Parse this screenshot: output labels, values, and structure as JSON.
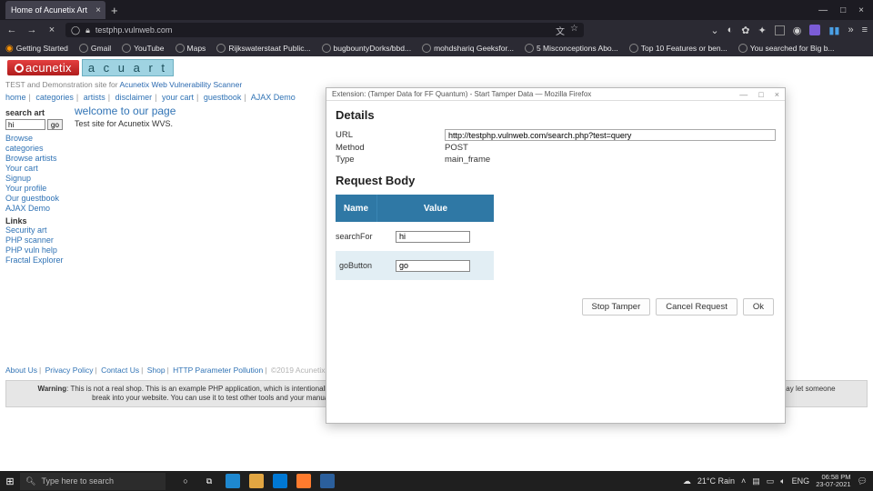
{
  "browser": {
    "tab_title": "Home of Acunetix Art",
    "url": "testphp.vulnweb.com",
    "bookmarks": [
      "Getting Started",
      "Gmail",
      "YouTube",
      "Maps",
      "Rijkswaterstaat Public...",
      "bugbountyDorks/bbd...",
      "mohdshariq Geeksfor...",
      "5 Misconceptions Abo...",
      "Top 10 Features or ben...",
      "You searched for Big b..."
    ]
  },
  "header": {
    "tagline_prefix": "TEST and Demonstration site for ",
    "tagline_link": "Acunetix Web Vulnerability Scanner",
    "menu": [
      "home",
      "categories",
      "artists",
      "disclaimer",
      "your cart",
      "guestbook",
      "AJAX Demo"
    ]
  },
  "sidebar": {
    "search_hdr": "search art",
    "search_value": "hi",
    "go_label": "go",
    "links1": [
      "Browse categories",
      "Browse artists",
      "Your cart",
      "Signup",
      "Your profile",
      "Our guestbook",
      "AJAX Demo"
    ],
    "links_hdr": "Links",
    "links2": [
      "Security art",
      "PHP scanner",
      "PHP vuln help",
      "Fractal Explorer"
    ]
  },
  "main": {
    "title": "welcome to our page",
    "text": "Test site for Acunetix WVS."
  },
  "footer": {
    "items": [
      "About Us",
      "Privacy Policy",
      "Contact Us",
      "Shop",
      "HTTP Parameter Pollution"
    ],
    "copy": "©2019 Acunetix Ltd"
  },
  "warning": {
    "title": "Warning",
    "body": ": This is not a real shop. This is an example PHP application, which is intentionally vulnerable to web attacks. It is intended to help you test Acunetix. It also helps you understand how developer errors and bad configuration may let someone break into your website. You can use it to test other tools and your manual hacking skills as well. Tip: Look for potential SQL Injections, Cross-site Scripting (XSS), and Cross-site Request Forgery (CSRF), and more."
  },
  "modal": {
    "window_title": "Extension: (Tamper Data for FF Quantum) - Start Tamper Data — Mozilla Firefox",
    "details_hdr": "Details",
    "url_k": "URL",
    "url_v": "http://testphp.vulnweb.com/search.php?test=query",
    "method_k": "Method",
    "method_v": "POST",
    "type_k": "Type",
    "type_v": "main_frame",
    "body_hdr": "Request Body",
    "col_name": "Name",
    "col_value": "Value",
    "r1_name": "searchFor",
    "r1_value": "hi",
    "r2_name": "goButton",
    "r2_value": "go",
    "btn_stop": "Stop Tamper",
    "btn_cancel": "Cancel Request",
    "btn_ok": "Ok"
  },
  "taskbar": {
    "search_placeholder": "Type here to search",
    "weather": "21°C Rain",
    "lang": "ENG",
    "time": "06:58 PM",
    "date": "23-07-2021"
  }
}
